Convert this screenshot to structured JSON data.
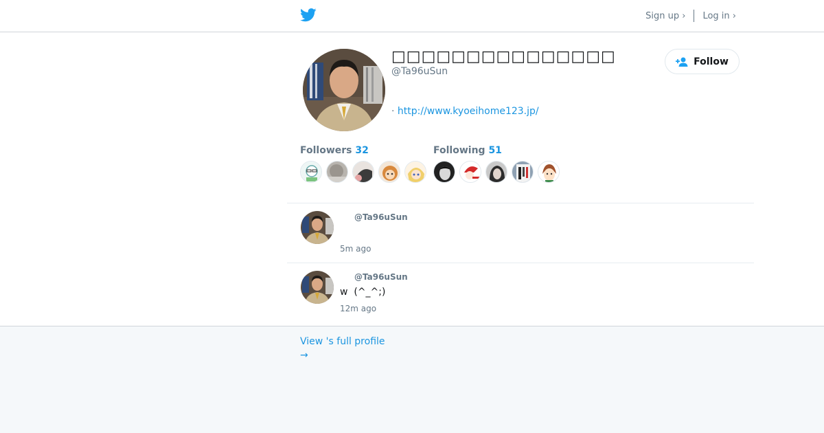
{
  "nav": {
    "signup_label": "Sign up ›",
    "login_label": "Log in ›"
  },
  "profile": {
    "display_name": "□□□□□□□□□□□□□□□",
    "handle": "@Ta96uSun",
    "url_prefix": "·",
    "url": "http://www.kyoeihome123.jp/",
    "follow_label": "Follow"
  },
  "stats": {
    "followers": {
      "label": "Followers",
      "count": "32"
    },
    "following": {
      "label": "Following",
      "count": "51"
    }
  },
  "tweets": [
    {
      "handle": "@Ta96uSun",
      "text": "",
      "time": "5m ago"
    },
    {
      "handle": "@Ta96uSun",
      "text": "w  (^_^;)",
      "time": "12m ago"
    }
  ],
  "footer": {
    "full_profile_label": "View 's full profile",
    "arrow": "→"
  },
  "colors": {
    "accent": "#1b95e0",
    "twitter_blue": "#1da1f2",
    "muted": "#657786",
    "footer_bg": "#f5f8fa"
  }
}
